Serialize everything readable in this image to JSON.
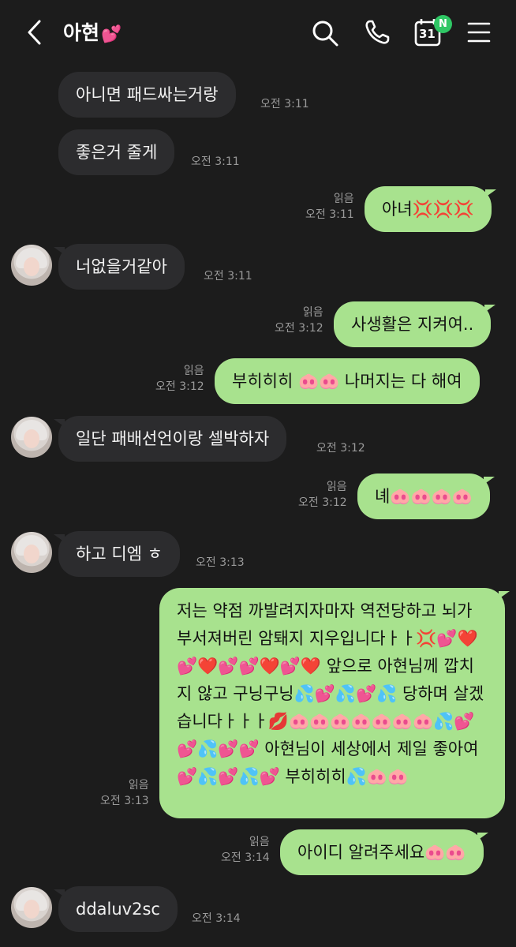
{
  "header": {
    "back_icon": "chevron-left-icon",
    "title": "아현",
    "title_emoji": "💕",
    "calendar_day": "31",
    "calendar_badge": "N"
  },
  "messages": [
    {
      "dir": "in",
      "text": "아니면 패드싸는거랑",
      "time": "오전 3:11",
      "avatar": false
    },
    {
      "dir": "in",
      "text": "좋은거 줄게",
      "time": "오전 3:11",
      "avatar": false
    },
    {
      "dir": "out",
      "text": "아녀💢💢💢",
      "time": "오전 3:11",
      "read": "읽음"
    },
    {
      "dir": "in",
      "text": "너없을거같아",
      "time": "오전 3:11",
      "avatar": true
    },
    {
      "dir": "out",
      "text": "사생활은 지켜여..",
      "time": "오전 3:12",
      "read": "읽음"
    },
    {
      "dir": "out",
      "text": "부히히히 🐽🐽 나머지는 다 해여",
      "time": "오전 3:12",
      "read": "읽음"
    },
    {
      "dir": "in",
      "text": "일단 패배선언이랑 셀박하자",
      "time": "오전 3:12",
      "avatar": true
    },
    {
      "dir": "out",
      "text": "녜🐽🐽🐽🐽",
      "time": "오전 3:12",
      "read": "읽음"
    },
    {
      "dir": "in",
      "text": "하고 디엠 ㅎ",
      "time": "오전 3:13",
      "avatar": true
    },
    {
      "dir": "out",
      "text": "저는 약점 까발려지자마자 역전당하고 뇌가 부서져버린 암퇘지 지우입니다ㅏㅏ💢💕❤️💕❤️💕💕❤️💕❤️ 앞으로 아현님께 깝치지 않고 구닝구닝💦💕💦💕💦 당하며 살겠습니다ㅏㅏㅏ💋🐽🐽🐽🐽🐽🐽🐽💦💕💕💦💕💕 아현님이 세상에서 제일 좋아여💕💦💕💦💕 부히히히💦🐽🐽",
      "time": "오전 3:13",
      "read": "읽음"
    },
    {
      "dir": "out",
      "text": "아이디 알려주세요🐽🐽",
      "time": "오전 3:14",
      "read": "읽음"
    },
    {
      "dir": "in",
      "text": "ddaluv2sc",
      "time": "오전 3:14",
      "avatar": true
    }
  ]
}
